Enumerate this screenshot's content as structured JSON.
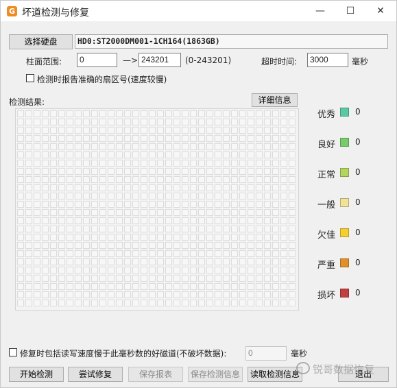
{
  "window": {
    "title": "坏道检测与修复",
    "app_icon_glyph": "G",
    "controls": {
      "minimize": "—",
      "maximize": "☐",
      "close": "✕"
    }
  },
  "disk": {
    "select_button": "选择硬盘",
    "name": "HD0:ST2000DM001-1CH164(1863GB)"
  },
  "range": {
    "label": "柱面范围:",
    "start": "0",
    "arrow": "—>",
    "end": "243201",
    "hint": "(0-243201)"
  },
  "timeout": {
    "label": "超时时间:",
    "value": "3000",
    "unit": "毫秒"
  },
  "report_checkbox_label": "检测时报告准确的扇区号(速度较慢)",
  "results": {
    "label": "检测结果:",
    "detail_button": "详细信息"
  },
  "legend": [
    {
      "label": "优秀",
      "color": "#5bc8a2",
      "count": "0"
    },
    {
      "label": "良好",
      "color": "#76cc6a",
      "count": "0"
    },
    {
      "label": "正常",
      "color": "#b3d560",
      "count": "0"
    },
    {
      "label": "一般",
      "color": "#f1e29a",
      "count": "0"
    },
    {
      "label": "欠佳",
      "color": "#f5cf30",
      "count": "0"
    },
    {
      "label": "严重",
      "color": "#e0902a",
      "count": "0"
    },
    {
      "label": "损坏",
      "color": "#c0403f",
      "count": "0"
    }
  ],
  "repair": {
    "checkbox_label": "修复时包括读写速度慢于此毫秒数的好磁道(不破坏数据):",
    "value": "0",
    "unit": "毫秒"
  },
  "buttons": {
    "start": "开始检测",
    "try_repair": "尝试修复",
    "save_report": "保存报表",
    "save_result": "保存检测信息",
    "read_result": "读取检测信息",
    "exit": "退出"
  },
  "watermark": "锐哥数据恢复"
}
